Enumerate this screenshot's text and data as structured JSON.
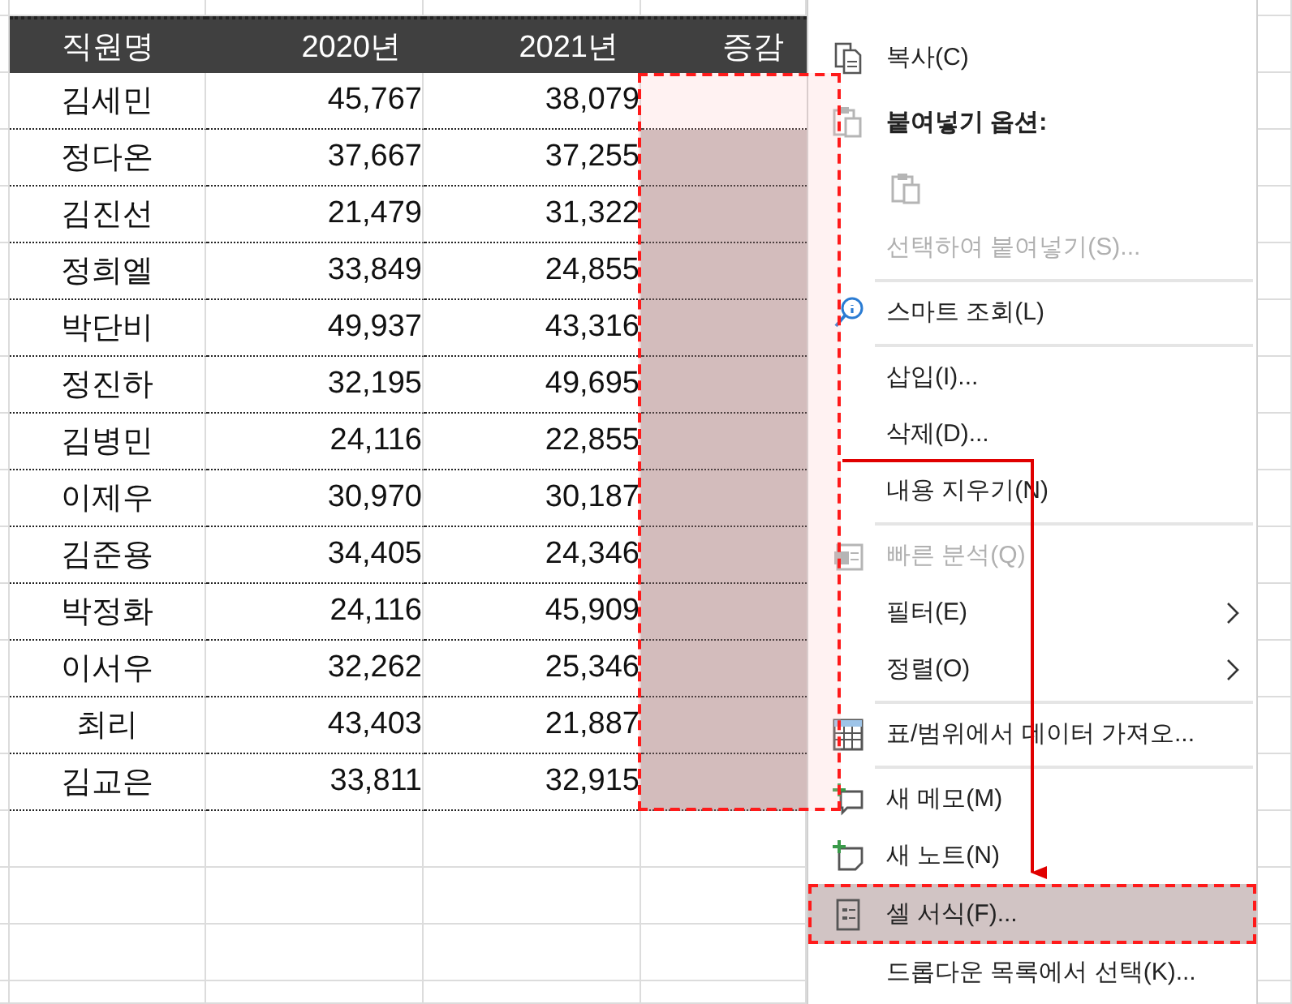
{
  "sheet": {
    "columns": [
      "직원명",
      "2020년",
      "2021년",
      "증감"
    ],
    "rows": [
      {
        "cells": [
          "김세민",
          "45,767",
          "38,079"
        ]
      },
      {
        "cells": [
          "정다온",
          "37,667",
          "37,255"
        ]
      },
      {
        "cells": [
          "김진선",
          "21,479",
          "31,322"
        ]
      },
      {
        "cells": [
          "정희엘",
          "33,849",
          "24,855"
        ]
      },
      {
        "cells": [
          "박단비",
          "49,937",
          "43,316"
        ]
      },
      {
        "cells": [
          "정진하",
          "32,195",
          "49,695"
        ]
      },
      {
        "cells": [
          "김병민",
          "24,116",
          "22,855"
        ]
      },
      {
        "cells": [
          "이제우",
          "30,970",
          "30,187"
        ]
      },
      {
        "cells": [
          "김준용",
          "34,405",
          "24,346"
        ]
      },
      {
        "cells": [
          "박정화",
          "24,116",
          "45,909"
        ]
      },
      {
        "cells": [
          "이서우",
          "32,262",
          "25,346"
        ]
      },
      {
        "cells": [
          "최리",
          "43,403",
          "21,887"
        ]
      },
      {
        "cells": [
          "김교은",
          "33,811",
          "32,915"
        ]
      }
    ]
  },
  "context_menu": {
    "items": [
      {
        "kind": "item",
        "label": "복사(C)",
        "disabled": false,
        "submenu": false,
        "selected": false
      },
      {
        "kind": "header",
        "label": "붙여넣기 옵션:"
      },
      {
        "kind": "paste-options"
      },
      {
        "kind": "item",
        "label": "선택하여 붙여넣기(S)...",
        "disabled": true,
        "submenu": false,
        "selected": false
      },
      {
        "kind": "separator"
      },
      {
        "kind": "item",
        "label": "스마트 조회(L)",
        "disabled": false,
        "submenu": false,
        "selected": false
      },
      {
        "kind": "separator"
      },
      {
        "kind": "item",
        "label": "삽입(I)...",
        "disabled": false,
        "submenu": false,
        "selected": false
      },
      {
        "kind": "item",
        "label": "삭제(D)...",
        "disabled": false,
        "submenu": false,
        "selected": false
      },
      {
        "kind": "item",
        "label": "내용 지우기(N)",
        "disabled": false,
        "submenu": false,
        "selected": false
      },
      {
        "kind": "separator"
      },
      {
        "kind": "item",
        "label": "빠른 분석(Q)",
        "disabled": true,
        "submenu": false,
        "selected": false
      },
      {
        "kind": "item",
        "label": "필터(E)",
        "disabled": false,
        "submenu": true,
        "selected": false
      },
      {
        "kind": "item",
        "label": "정렬(O)",
        "disabled": false,
        "submenu": true,
        "selected": false
      },
      {
        "kind": "separator"
      },
      {
        "kind": "item",
        "label": "표/범위에서 데이터 가져오...",
        "disabled": false,
        "submenu": false,
        "selected": false
      },
      {
        "kind": "separator"
      },
      {
        "kind": "item",
        "label": "새 메모(M)",
        "disabled": false,
        "submenu": false,
        "selected": false
      },
      {
        "kind": "item",
        "label": "새 노트(N)",
        "disabled": false,
        "submenu": false,
        "selected": false
      },
      {
        "kind": "item",
        "label": "셀 서식(F)...",
        "disabled": false,
        "submenu": false,
        "selected": true
      },
      {
        "kind": "item",
        "label": "드롭다운 목록에서 선택(K)...",
        "disabled": false,
        "submenu": false,
        "selected": false
      }
    ]
  }
}
